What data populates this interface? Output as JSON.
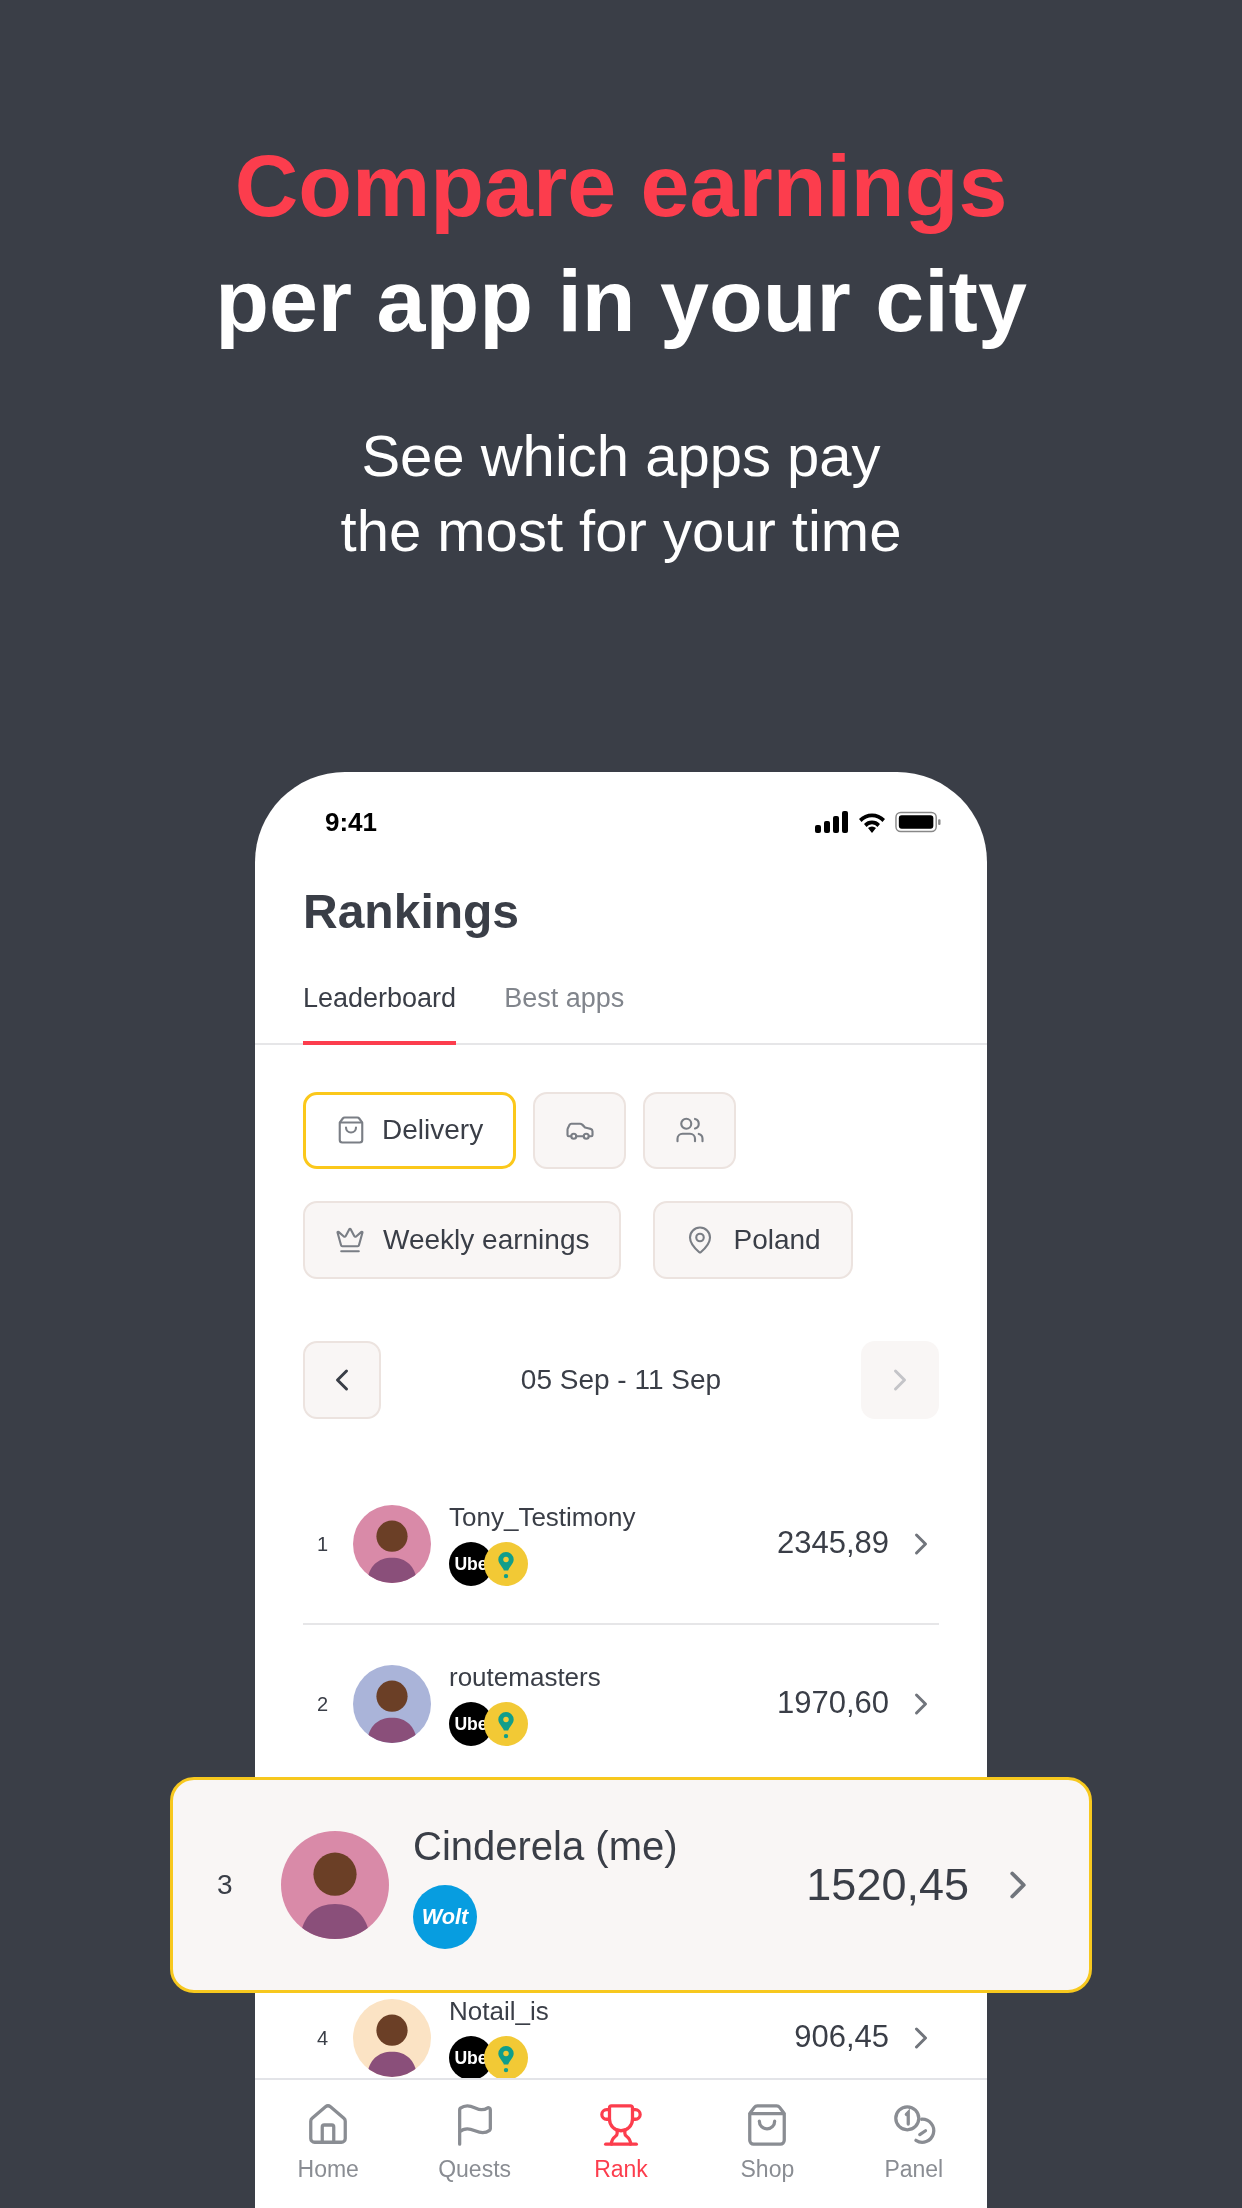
{
  "headline": {
    "accent": "Compare earnings",
    "rest": "per app in your city"
  },
  "subtitle_lines": [
    "See which apps pay",
    "the most for your time"
  ],
  "phone": {
    "status_bar": {
      "time": "9:41"
    },
    "title": "Rankings",
    "tabs": [
      {
        "label": "Leaderboard",
        "selected": true
      },
      {
        "label": "Best apps",
        "selected": false
      }
    ],
    "categories": [
      {
        "kind": "bag",
        "label": "Delivery",
        "selected": true
      },
      {
        "kind": "car",
        "selected": false
      },
      {
        "kind": "people",
        "selected": false
      }
    ],
    "filters": [
      {
        "kind": "crown",
        "label": "Weekly earnings"
      },
      {
        "kind": "pin",
        "label": "Poland"
      }
    ],
    "date_range": {
      "label": "05 Sep - 11 Sep",
      "prev_disabled": false,
      "next_disabled": true
    },
    "rows": [
      {
        "rank": "1",
        "name": "Tony_Testimony",
        "amount": "2345,89",
        "color": "#d98aa8",
        "apps": [
          {
            "kind": "uber",
            "label": "Ube"
          },
          {
            "kind": "pin"
          }
        ]
      },
      {
        "rank": "2",
        "name": "routemasters",
        "amount": "1970,60",
        "color": "#aab4d9",
        "apps": [
          {
            "kind": "uber",
            "label": "Ube"
          },
          {
            "kind": "pin"
          }
        ]
      },
      {
        "rank": "4",
        "name": "Notail_is",
        "amount": "906,45",
        "color": "#fbe3c4",
        "apps": [
          {
            "kind": "uber",
            "label": "Ube"
          },
          {
            "kind": "pin"
          }
        ]
      }
    ],
    "current_user": {
      "rank": "3",
      "name": "Cinderela (me)",
      "amount": "1520,45",
      "color": "#d98aa8",
      "apps": [
        {
          "kind": "wolt",
          "label": "Wolt"
        }
      ]
    },
    "nav": [
      {
        "kind": "home",
        "label": "Home",
        "selected": false
      },
      {
        "kind": "flag",
        "label": "Quests",
        "selected": false
      },
      {
        "kind": "trophy",
        "label": "Rank",
        "selected": true
      },
      {
        "kind": "bag",
        "label": "Shop",
        "selected": false
      },
      {
        "kind": "coins",
        "label": "Panel",
        "selected": false
      }
    ]
  }
}
